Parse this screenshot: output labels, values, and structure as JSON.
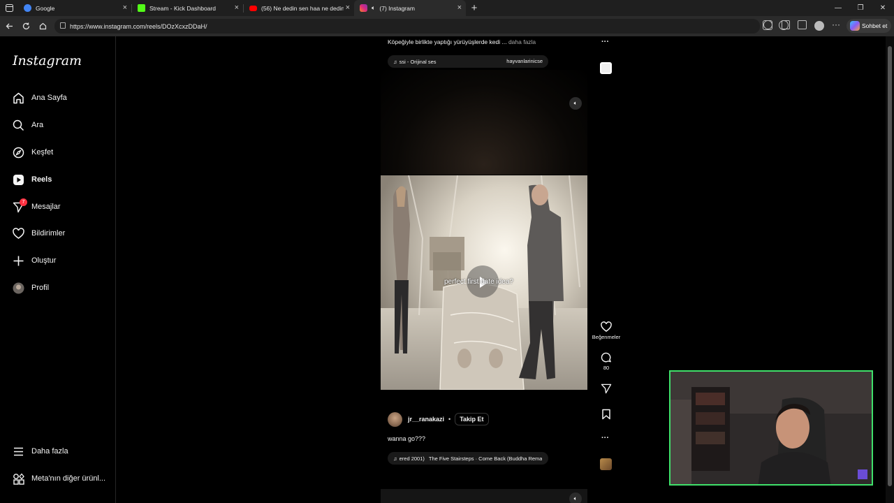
{
  "browser": {
    "tabs": [
      {
        "title": "Google",
        "favicon": "google-icon",
        "color": "#4285f4"
      },
      {
        "title": "Stream - Kick Dashboard",
        "favicon": "kick-icon",
        "color": "#53fc18"
      },
      {
        "title": "(56) Ne dedin sen haa ne dedin s...",
        "favicon": "youtube-icon",
        "color": "#ff0000"
      },
      {
        "title": "(7) Instagram",
        "favicon": "instagram-icon",
        "color": "#e1306c"
      }
    ],
    "url": "https://www.instagram.com/reels/DOzXcxzDDaH/",
    "chat_button": "Sohbet et"
  },
  "sidebar": {
    "logo": "Instagram",
    "items": [
      {
        "label": "Ana Sayfa",
        "icon": "home-icon"
      },
      {
        "label": "Ara",
        "icon": "search-icon"
      },
      {
        "label": "Keşfet",
        "icon": "compass-icon"
      },
      {
        "label": "Reels",
        "icon": "reels-icon"
      },
      {
        "label": "Mesajlar",
        "icon": "messenger-icon",
        "badge": "7"
      },
      {
        "label": "Bildirimler",
        "icon": "heart-icon"
      },
      {
        "label": "Oluştur",
        "icon": "plus-icon"
      },
      {
        "label": "Profil",
        "icon": "avatar-icon"
      }
    ],
    "bottom": [
      {
        "label": "Daha fazla",
        "icon": "menu-icon"
      },
      {
        "label": "Meta'nın diğer ürünl...",
        "icon": "meta-apps-icon"
      }
    ]
  },
  "reel_top": {
    "caption": "Köpeğiyle birlikte yaptığı yürüyüşlerde kedi ...",
    "more": "daha fazla",
    "audio_left": "ssi - Orijinal ses",
    "audio_right": "hayvanlarinicse"
  },
  "reel": {
    "overlay_text": "perfect first date idea?",
    "like_label": "Beğenmeler",
    "comment_count": "80",
    "username": "jr__ranakazi",
    "follow": "Takip Et",
    "caption": "wanna go???",
    "audio_left": "ered 2001)",
    "audio_right": "The Five Stairsteps · Come Back (Buddha Rema"
  }
}
